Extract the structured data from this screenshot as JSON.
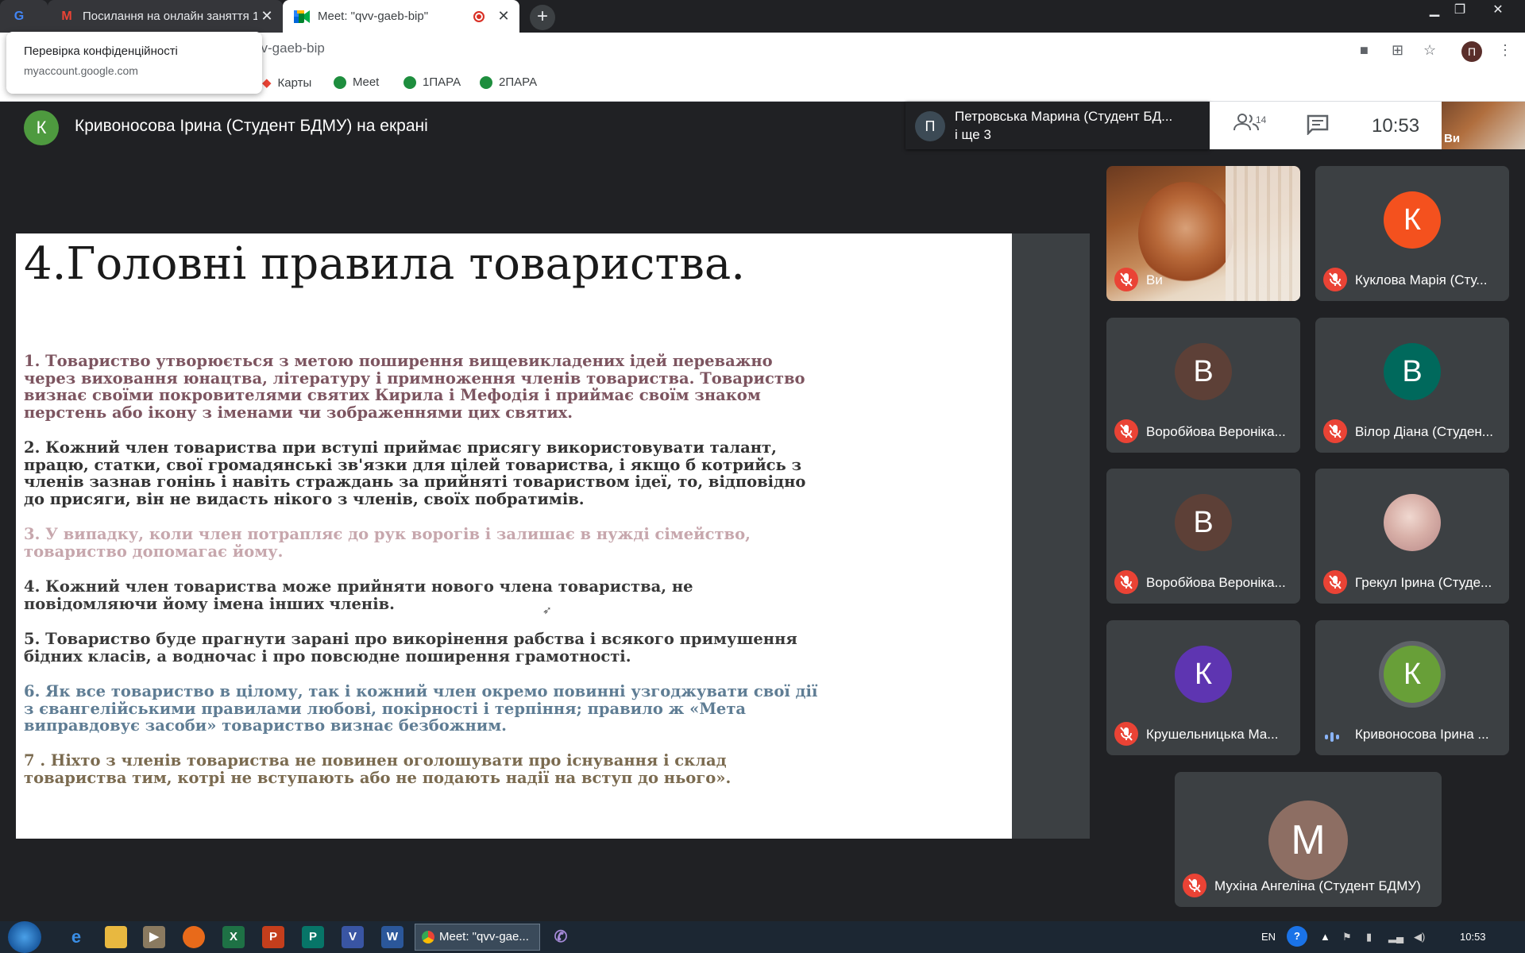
{
  "browser": {
    "tabs": [
      {
        "title": "",
        "favicon": "G"
      },
      {
        "title": "Посилання на онлайн заняття 1",
        "favicon": "M"
      },
      {
        "title": "Meet: \"qvv-gaeb-bip\"",
        "favicon": "meet-icon",
        "recording": true
      }
    ],
    "new_tab_label": "+",
    "url": "vv-gaeb-bip",
    "bookmarks": [
      "Карты",
      "Meet",
      "1ПАРА",
      "2ПАРА"
    ],
    "profile_initial": "П",
    "privacy_popup": {
      "title": "Перевірка конфіденційності",
      "domain": "myaccount.google.com"
    }
  },
  "meet": {
    "presenter": {
      "initial": "К",
      "text": "Кривоносова Ірина (Студент БДМУ) на екрані"
    },
    "speaker": {
      "initial": "П",
      "name": "Петровська Марина (Студент БД...",
      "more": "і ще 3"
    },
    "people_count": "14",
    "time": "10:53",
    "self_label": "Ви",
    "slide": {
      "title": "4.Головні правила товариства.",
      "rules": [
        "1. Товариство утворюється з метою поширення вищевикладених ідей переважно через виховання юнацтва, літературу і примноження членів товариства. Товариство визнає своїми покровителями святих Кирила і Мефодія і приймає своїм знаком перстень або ікону з іменами чи зображеннями цих святих.",
        "2. Кожний член товариства при вступі приймає присягу використовувати талант, працю, статки, свої громадянські зв'язки для цілей товариства, і якщо б котрийсь з членів зазнав гонінь і навіть страждань за прийняті товариством ідеї, то, відповідно до присяги, він не видасть нікого з членів, своїх побратимів.",
        "3. У випадку, коли член потрапляє до рук ворогів і залишає в нужді сімейство, товариство допомагає йому.",
        "4. Кожний член товариства може прийняти нового члена товариства, не повідомляючи йому імена інших членів.",
        "5. Товариство буде прагнути зарані про викорінення рабства і всякого примушення бідних класів, а водночас і про повсюдне поширення грамотності.",
        "6. Як все товариство в цілому, так і кожний член окремо повинні узгоджувати свої дії з євангелійськими правилами любові, покірності і терпіння; правило ж «Мета виправдовує засоби» товариство визнає безбожним.",
        "7 . Ніхто з членів товариства не повинен оголошувати про існування і склад товариства тим, котрі не вступають або не подають надії на вступ до нього»."
      ]
    },
    "participants": [
      {
        "name": "Ви",
        "initial": "",
        "color": "",
        "muted": true
      },
      {
        "name": "Куклова Марія (Сту...",
        "initial": "К",
        "color": "#f4511e",
        "muted": true
      },
      {
        "name": "Воробйова Вероніка...",
        "initial": "В",
        "color": "#5d4037",
        "muted": true
      },
      {
        "name": "Вілор Діана (Студен...",
        "initial": "В",
        "color": "#00695c",
        "muted": true
      },
      {
        "name": "Воробйова Вероніка...",
        "initial": "В",
        "color": "#5d4037",
        "muted": true
      },
      {
        "name": "Грекул Ірина (Студе...",
        "initial": "",
        "color": "",
        "muted": true
      },
      {
        "name": "Крушельницька Ма...",
        "initial": "К",
        "color": "#5e35b1",
        "muted": true
      },
      {
        "name": "Кривоносова Ірина ...",
        "initial": "К",
        "color": "#689f38",
        "muted": false
      },
      {
        "name": "Мухіна Ангеліна (Студент БДМУ)",
        "initial": "М",
        "color": "#8d6e63",
        "muted": true
      }
    ]
  },
  "taskbar": {
    "active_task": "Meet: \"qvv-gae...",
    "lang": "EN",
    "time": "10:53"
  }
}
